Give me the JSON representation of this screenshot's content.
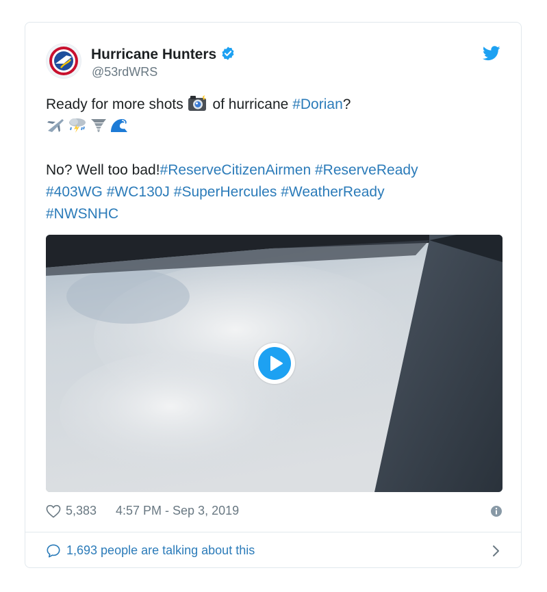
{
  "tweet": {
    "author_name": "Hurricane Hunters",
    "author_handle": "@53rdWRS",
    "text_line1_pre": "Ready for more shots",
    "text_line1_post": "of hurricane",
    "hashtag_dorian": "#Dorian",
    "text_line1_end": "?",
    "text_line3_pre": "No? Well too bad!",
    "hashtag_reserve_citizen": "#ReserveCitizenAirmen",
    "hashtag_reserve_ready": "#ReserveReady",
    "hashtag_403wg": "#403WG",
    "hashtag_wc130j": "#WC130J",
    "hashtag_superhercules": "#SuperHercules",
    "hashtag_weatherready": "#WeatherReady",
    "hashtag_nwsnhc": "#NWSNHC",
    "emojis": [
      "camera-flash-icon",
      "airplane-icon",
      "cloud-lightning-rain-icon",
      "tornado-icon",
      "wave-icon"
    ]
  },
  "meta": {
    "likes": "5,383",
    "timestamp": "4:57 PM - Sep 3, 2019"
  },
  "footer": {
    "talking": "1,693 people are talking about this"
  },
  "colors": {
    "link": "#2b7bb9",
    "twitter_blue": "#1da1f2",
    "secondary_text": "#697882",
    "border": "#e1e8ed"
  }
}
